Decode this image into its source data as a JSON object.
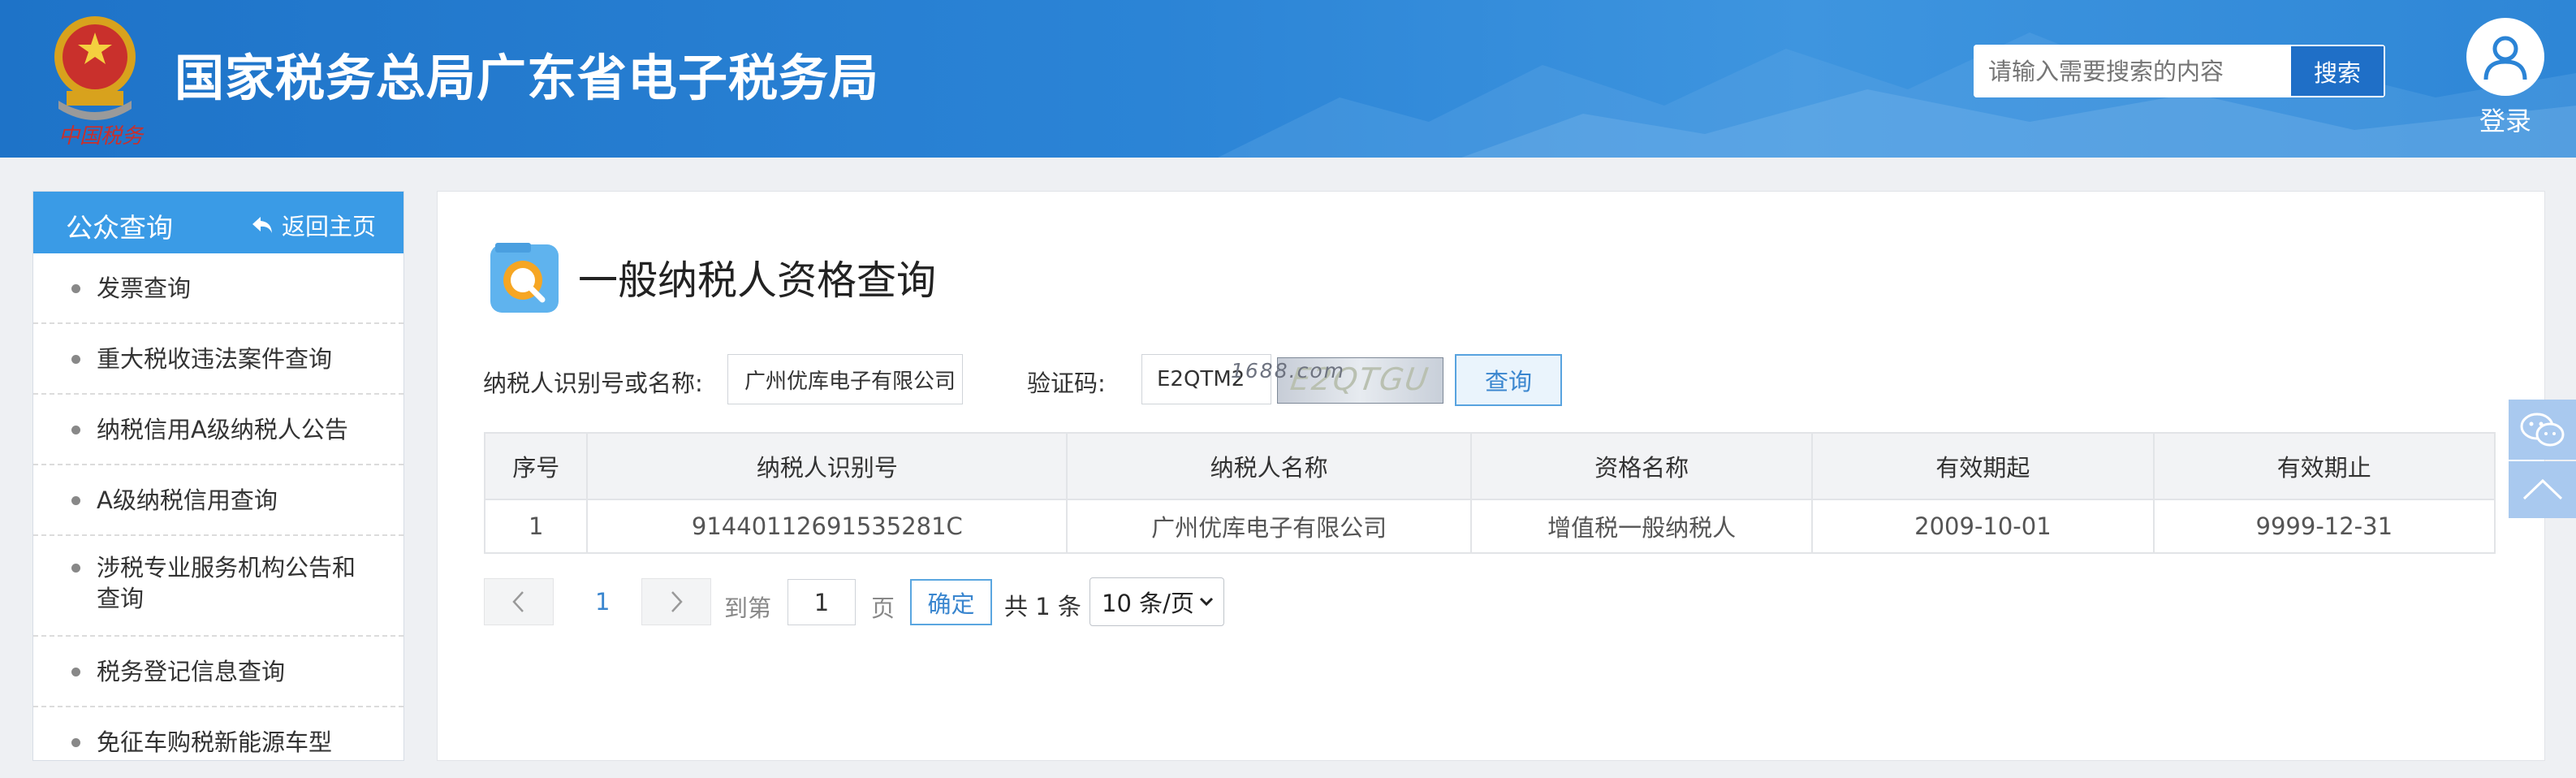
{
  "header": {
    "site_title": "国家税务总局广东省电子税务局",
    "emblem_caption": "中国税务",
    "search_placeholder": "请输入需要搜索的内容",
    "search_button": "搜索",
    "login_label": "登录"
  },
  "sidebar": {
    "title": "公众查询",
    "back_label": "返回主页",
    "items": [
      {
        "label": "发票查询"
      },
      {
        "label": "重大税收违法案件查询"
      },
      {
        "label": "纳税信用A级纳税人公告"
      },
      {
        "label": "A级纳税信用查询"
      },
      {
        "label": "涉税专业服务机构公告和查询"
      },
      {
        "label": "税务登记信息查询"
      },
      {
        "label": "免征车购税新能源车型"
      }
    ]
  },
  "main": {
    "title": "一般纳税人资格查询",
    "form": {
      "taxpayer_label": "纳税人识别号或名称:",
      "taxpayer_value": "广州优库电子有限公司",
      "captcha_label": "验证码:",
      "captcha_value": "E2QTM2",
      "captcha_image_text": "E2QTGU",
      "watermark": "1688.com",
      "query_button": "查询"
    },
    "table": {
      "columns": [
        "序号",
        "纳税人识别号",
        "纳税人名称",
        "资格名称",
        "有效期起",
        "有效期止"
      ],
      "rows": [
        [
          "1",
          "91440112691535281C",
          "广州优库电子有限公司",
          "增值税一般纳税人",
          "2009-10-01",
          "9999-12-31"
        ]
      ]
    },
    "pagination": {
      "current_page": "1",
      "goto_label": "到第",
      "goto_value": "1",
      "page_unit": "页",
      "confirm_button": "确定",
      "total_label": "共 1 条",
      "page_size": "10 条/页"
    }
  },
  "colors": {
    "header_blue": "#2b84d6",
    "sidebar_head": "#3a9be6",
    "link_blue": "#3a86cf"
  },
  "icons": {
    "emblem": "national-tax-emblem",
    "user": "user-icon",
    "back": "back-arrow-icon",
    "title": "search-document-icon",
    "wechat": "wechat-icon",
    "top": "chevron-up-icon"
  }
}
